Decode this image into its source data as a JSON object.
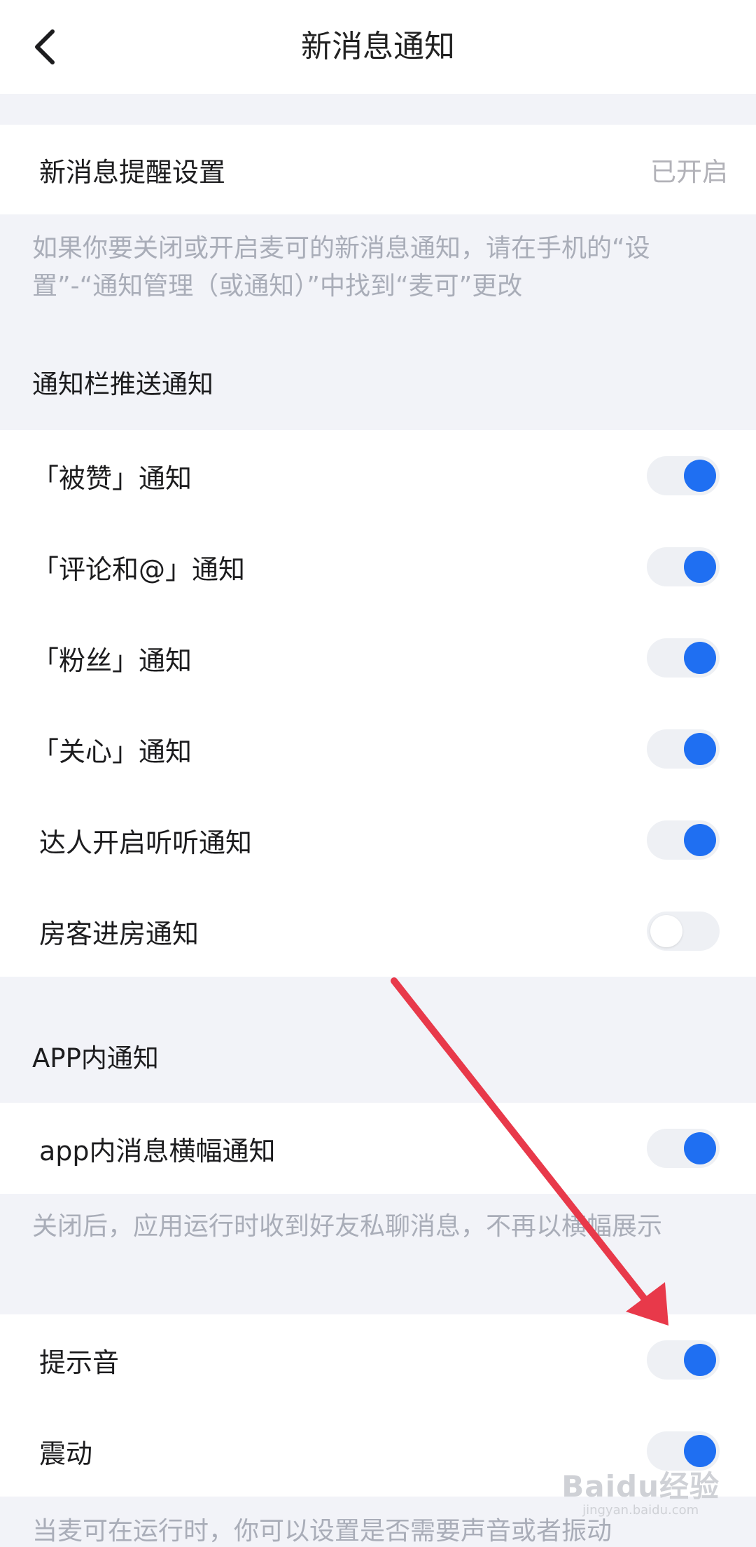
{
  "header": {
    "title": "新消息通知"
  },
  "reminder": {
    "label": "新消息提醒设置",
    "value": "已开启"
  },
  "reminder_note": "如果你要关闭或开启麦可的新消息通知，请在手机的“设置”-“通知管理（或通知）”中找到“麦可”更改",
  "push_section": {
    "title": "通知栏推送通知",
    "items": [
      {
        "label": "「被赞」通知",
        "enabled": true
      },
      {
        "label": "「评论和@」通知",
        "enabled": true
      },
      {
        "label": "「粉丝」通知",
        "enabled": true
      },
      {
        "label": "「关心」通知",
        "enabled": true
      },
      {
        "label": "达人开启听听通知",
        "enabled": true
      },
      {
        "label": "房客进房通知",
        "enabled": false
      }
    ]
  },
  "app_section": {
    "title": "APP内通知",
    "banner": {
      "label": "app内消息横幅通知",
      "enabled": true
    },
    "banner_note": "关闭后，应用运行时收到好友私聊消息，不再以横幅展示",
    "sound": {
      "label": "提示音",
      "enabled": true
    },
    "vibrate": {
      "label": "震动",
      "enabled": true
    },
    "bottom_note": "当麦可在运行时，你可以设置是否需要声音或者振动"
  },
  "colors": {
    "accent": "#1f6ff2",
    "annotation_arrow": "#e8394a",
    "background": "#f2f3f8"
  },
  "watermark": {
    "main": "Baidu经验",
    "sub": "jingyan.baidu.com"
  }
}
